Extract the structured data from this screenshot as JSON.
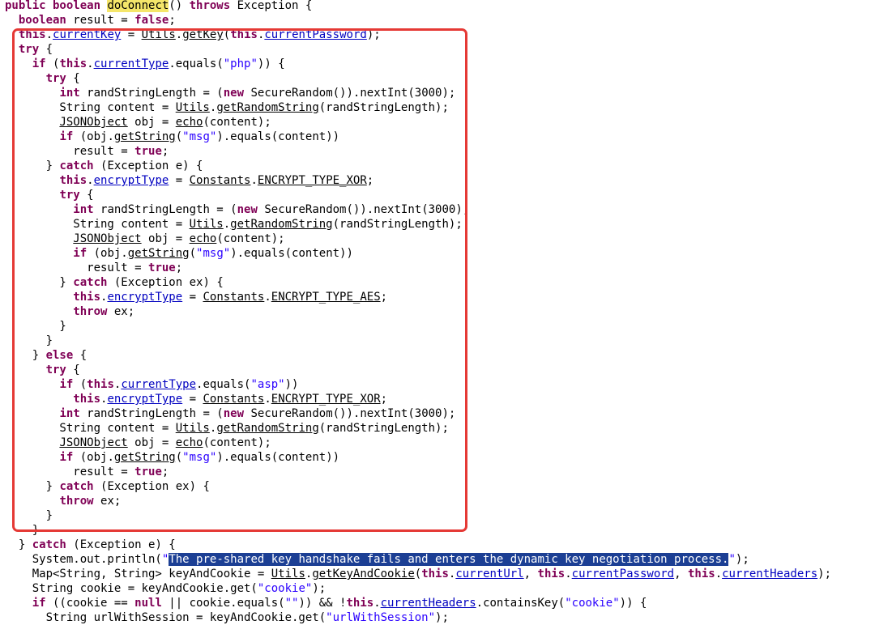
{
  "colors": {
    "keyword": "#7f0055",
    "string": "#2a00ff",
    "field": "#0000c0",
    "text": "#000000",
    "background": "#ffffff",
    "highlight_word": "#f5e66a",
    "selection": "#1c3f94",
    "callout_border": "#e53935"
  },
  "code": {
    "lines": [
      [
        {
          "t": "public boolean ",
          "s": "kw"
        },
        {
          "t": "doConnect",
          "s": "hl-yellow"
        },
        {
          "t": "() "
        },
        {
          "t": "throws",
          "s": "kw"
        },
        {
          "t": " Exception {"
        }
      ],
      [
        {
          "t": "  "
        },
        {
          "t": "boolean",
          "s": "kw"
        },
        {
          "t": " result = "
        },
        {
          "t": "false",
          "s": "kw"
        },
        {
          "t": ";"
        }
      ],
      [
        {
          "t": "  "
        },
        {
          "t": "this",
          "s": "kw"
        },
        {
          "t": "."
        },
        {
          "t": "currentKey",
          "s": "fld ul"
        },
        {
          "t": " = "
        },
        {
          "t": "Utils",
          "s": "ul"
        },
        {
          "t": "."
        },
        {
          "t": "getKey",
          "s": "ul"
        },
        {
          "t": "("
        },
        {
          "t": "this",
          "s": "kw"
        },
        {
          "t": "."
        },
        {
          "t": "currentPassword",
          "s": "fld ul"
        },
        {
          "t": ");"
        }
      ],
      [
        {
          "t": "  "
        },
        {
          "t": "try",
          "s": "kw"
        },
        {
          "t": " {"
        }
      ],
      [
        {
          "t": "    "
        },
        {
          "t": "if",
          "s": "kw"
        },
        {
          "t": " ("
        },
        {
          "t": "this",
          "s": "kw"
        },
        {
          "t": "."
        },
        {
          "t": "currentType",
          "s": "fld ul"
        },
        {
          "t": ".equals("
        },
        {
          "t": "\"php\"",
          "s": "str"
        },
        {
          "t": ")) {"
        }
      ],
      [
        {
          "t": "      "
        },
        {
          "t": "try",
          "s": "kw"
        },
        {
          "t": " {"
        }
      ],
      [
        {
          "t": "        "
        },
        {
          "t": "int",
          "s": "kw"
        },
        {
          "t": " randStringLength = ("
        },
        {
          "t": "new",
          "s": "kw"
        },
        {
          "t": " SecureRandom()).nextInt(3000);"
        }
      ],
      [
        {
          "t": "        String content = "
        },
        {
          "t": "Utils",
          "s": "ul"
        },
        {
          "t": "."
        },
        {
          "t": "getRandomString",
          "s": "ul"
        },
        {
          "t": "(randStringLength);"
        }
      ],
      [
        {
          "t": "        "
        },
        {
          "t": "JSONObject",
          "s": "ul"
        },
        {
          "t": " obj = "
        },
        {
          "t": "echo",
          "s": "ul"
        },
        {
          "t": "(content);"
        }
      ],
      [
        {
          "t": "        "
        },
        {
          "t": "if",
          "s": "kw"
        },
        {
          "t": " (obj."
        },
        {
          "t": "getString",
          "s": "ul"
        },
        {
          "t": "("
        },
        {
          "t": "\"msg\"",
          "s": "str"
        },
        {
          "t": ").equals(content))"
        }
      ],
      [
        {
          "t": "          result = "
        },
        {
          "t": "true",
          "s": "kw"
        },
        {
          "t": ";"
        }
      ],
      [
        {
          "t": "      } "
        },
        {
          "t": "catch",
          "s": "kw"
        },
        {
          "t": " (Exception e) {"
        }
      ],
      [
        {
          "t": "        "
        },
        {
          "t": "this",
          "s": "kw"
        },
        {
          "t": "."
        },
        {
          "t": "encryptType",
          "s": "fld ul"
        },
        {
          "t": " = "
        },
        {
          "t": "Constants",
          "s": "ul"
        },
        {
          "t": "."
        },
        {
          "t": "ENCRYPT_TYPE_XOR",
          "s": "ul"
        },
        {
          "t": ";"
        }
      ],
      [
        {
          "t": "        "
        },
        {
          "t": "try",
          "s": "kw"
        },
        {
          "t": " {"
        }
      ],
      [
        {
          "t": "          "
        },
        {
          "t": "int",
          "s": "kw"
        },
        {
          "t": " randStringLength = ("
        },
        {
          "t": "new",
          "s": "kw"
        },
        {
          "t": " SecureRandom()).nextInt(3000);"
        }
      ],
      [
        {
          "t": "          String content = "
        },
        {
          "t": "Utils",
          "s": "ul"
        },
        {
          "t": "."
        },
        {
          "t": "getRandomString",
          "s": "ul"
        },
        {
          "t": "(randStringLength);"
        }
      ],
      [
        {
          "t": "          "
        },
        {
          "t": "JSONObject",
          "s": "ul"
        },
        {
          "t": " obj = "
        },
        {
          "t": "echo",
          "s": "ul"
        },
        {
          "t": "(content);"
        }
      ],
      [
        {
          "t": "          "
        },
        {
          "t": "if",
          "s": "kw"
        },
        {
          "t": " (obj."
        },
        {
          "t": "getString",
          "s": "ul"
        },
        {
          "t": "("
        },
        {
          "t": "\"msg\"",
          "s": "str"
        },
        {
          "t": ").equals(content))"
        }
      ],
      [
        {
          "t": "            result = "
        },
        {
          "t": "true",
          "s": "kw"
        },
        {
          "t": ";"
        }
      ],
      [
        {
          "t": "        } "
        },
        {
          "t": "catch",
          "s": "kw"
        },
        {
          "t": " (Exception ex) {"
        }
      ],
      [
        {
          "t": "          "
        },
        {
          "t": "this",
          "s": "kw"
        },
        {
          "t": "."
        },
        {
          "t": "encryptType",
          "s": "fld ul"
        },
        {
          "t": " = "
        },
        {
          "t": "Constants",
          "s": "ul"
        },
        {
          "t": "."
        },
        {
          "t": "ENCRYPT_TYPE_AES",
          "s": "ul"
        },
        {
          "t": ";"
        }
      ],
      [
        {
          "t": "          "
        },
        {
          "t": "throw",
          "s": "kw"
        },
        {
          "t": " ex;"
        }
      ],
      [
        {
          "t": "        }"
        }
      ],
      [
        {
          "t": "      }"
        }
      ],
      [
        {
          "t": "    } "
        },
        {
          "t": "else",
          "s": "kw"
        },
        {
          "t": " {"
        }
      ],
      [
        {
          "t": "      "
        },
        {
          "t": "try",
          "s": "kw"
        },
        {
          "t": " {"
        }
      ],
      [
        {
          "t": "        "
        },
        {
          "t": "if",
          "s": "kw"
        },
        {
          "t": " ("
        },
        {
          "t": "this",
          "s": "kw"
        },
        {
          "t": "."
        },
        {
          "t": "currentType",
          "s": "fld ul"
        },
        {
          "t": ".equals("
        },
        {
          "t": "\"asp\"",
          "s": "str"
        },
        {
          "t": "))"
        }
      ],
      [
        {
          "t": "          "
        },
        {
          "t": "this",
          "s": "kw"
        },
        {
          "t": "."
        },
        {
          "t": "encryptType",
          "s": "fld ul"
        },
        {
          "t": " = "
        },
        {
          "t": "Constants",
          "s": "ul"
        },
        {
          "t": "."
        },
        {
          "t": "ENCRYPT_TYPE_XOR",
          "s": "ul"
        },
        {
          "t": ";"
        }
      ],
      [
        {
          "t": "        "
        },
        {
          "t": "int",
          "s": "kw"
        },
        {
          "t": " randStringLength = ("
        },
        {
          "t": "new",
          "s": "kw"
        },
        {
          "t": " SecureRandom()).nextInt(3000);"
        }
      ],
      [
        {
          "t": "        String content = "
        },
        {
          "t": "Utils",
          "s": "ul"
        },
        {
          "t": "."
        },
        {
          "t": "getRandomString",
          "s": "ul"
        },
        {
          "t": "(randStringLength);"
        }
      ],
      [
        {
          "t": "        "
        },
        {
          "t": "JSONObject",
          "s": "ul"
        },
        {
          "t": " obj = "
        },
        {
          "t": "echo",
          "s": "ul"
        },
        {
          "t": "(content);"
        }
      ],
      [
        {
          "t": "        "
        },
        {
          "t": "if",
          "s": "kw"
        },
        {
          "t": " (obj."
        },
        {
          "t": "getString",
          "s": "ul"
        },
        {
          "t": "("
        },
        {
          "t": "\"msg\"",
          "s": "str"
        },
        {
          "t": ").equals(content))"
        }
      ],
      [
        {
          "t": "          result = "
        },
        {
          "t": "true",
          "s": "kw"
        },
        {
          "t": ";"
        }
      ],
      [
        {
          "t": "      } "
        },
        {
          "t": "catch",
          "s": "kw"
        },
        {
          "t": " (Exception ex) {"
        }
      ],
      [
        {
          "t": "        "
        },
        {
          "t": "throw",
          "s": "kw"
        },
        {
          "t": " ex;"
        }
      ],
      [
        {
          "t": "      }"
        }
      ],
      [
        {
          "t": "    }"
        }
      ],
      [
        {
          "t": "  } "
        },
        {
          "t": "catch",
          "s": "kw"
        },
        {
          "t": " (Exception e) {"
        }
      ],
      [
        {
          "t": "    System.out.println("
        },
        {
          "t": "\"",
          "s": "str"
        },
        {
          "t": "The pre-shared key handshake fails and enters the dynamic key negotiation process.",
          "s": "hl-select"
        },
        {
          "t": "\"",
          "s": "str"
        },
        {
          "t": ");"
        }
      ],
      [
        {
          "t": "    Map<String, String> keyAndCookie = "
        },
        {
          "t": "Utils",
          "s": "ul"
        },
        {
          "t": "."
        },
        {
          "t": "getKeyAndCookie",
          "s": "ul"
        },
        {
          "t": "("
        },
        {
          "t": "this",
          "s": "kw"
        },
        {
          "t": "."
        },
        {
          "t": "currentUrl",
          "s": "fld ul"
        },
        {
          "t": ", "
        },
        {
          "t": "this",
          "s": "kw"
        },
        {
          "t": "."
        },
        {
          "t": "currentPassword",
          "s": "fld ul"
        },
        {
          "t": ", "
        },
        {
          "t": "this",
          "s": "kw"
        },
        {
          "t": "."
        },
        {
          "t": "currentHeaders",
          "s": "fld ul"
        },
        {
          "t": ");"
        }
      ],
      [
        {
          "t": "    String cookie = keyAndCookie.get("
        },
        {
          "t": "\"cookie\"",
          "s": "str"
        },
        {
          "t": ");"
        }
      ],
      [
        {
          "t": "    "
        },
        {
          "t": "if",
          "s": "kw"
        },
        {
          "t": " ((cookie == "
        },
        {
          "t": "null",
          "s": "kw"
        },
        {
          "t": " || cookie.equals("
        },
        {
          "t": "\"\"",
          "s": "str"
        },
        {
          "t": ")) && !"
        },
        {
          "t": "this",
          "s": "kw"
        },
        {
          "t": "."
        },
        {
          "t": "currentHeaders",
          "s": "fld ul"
        },
        {
          "t": ".containsKey("
        },
        {
          "t": "\"cookie\"",
          "s": "str"
        },
        {
          "t": ")) {"
        }
      ],
      [
        {
          "t": "      String urlWithSession = keyAndCookie.get("
        },
        {
          "t": "\"urlWithSession\"",
          "s": "str"
        },
        {
          "t": ");"
        }
      ]
    ]
  }
}
